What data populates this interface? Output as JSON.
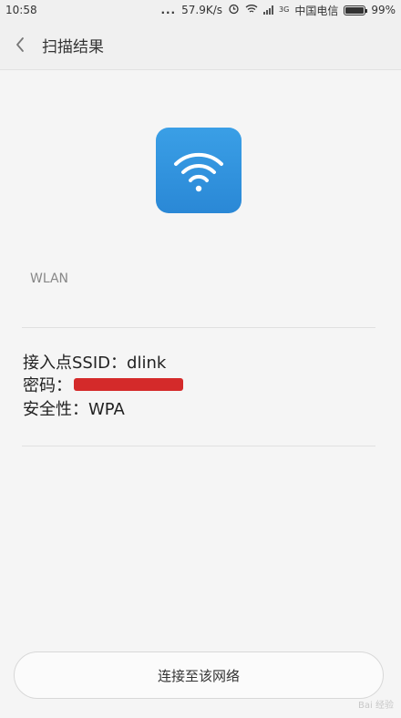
{
  "status_bar": {
    "time": "10:58",
    "dots": "...",
    "speed": "57.9K/s",
    "carrier": "中国电信",
    "battery": "99%",
    "battery_level": 0.99,
    "network_badge": "3G"
  },
  "header": {
    "back_icon": "chevron-left-icon",
    "title": "扫描结果"
  },
  "app_icon": "wifi-icon",
  "network_type": "WLAN",
  "info": {
    "ssid_label": "接入点SSID：",
    "ssid_value": "dlink",
    "password_label": "密码：",
    "security_label": "安全性：",
    "security_value": "WPA"
  },
  "actions": {
    "connect_label": "连接至该网络"
  },
  "watermark": "Bai 经验",
  "colors": {
    "accent": "#2a88d6",
    "mask": "#d42a2a",
    "background": "#f5f5f5"
  }
}
